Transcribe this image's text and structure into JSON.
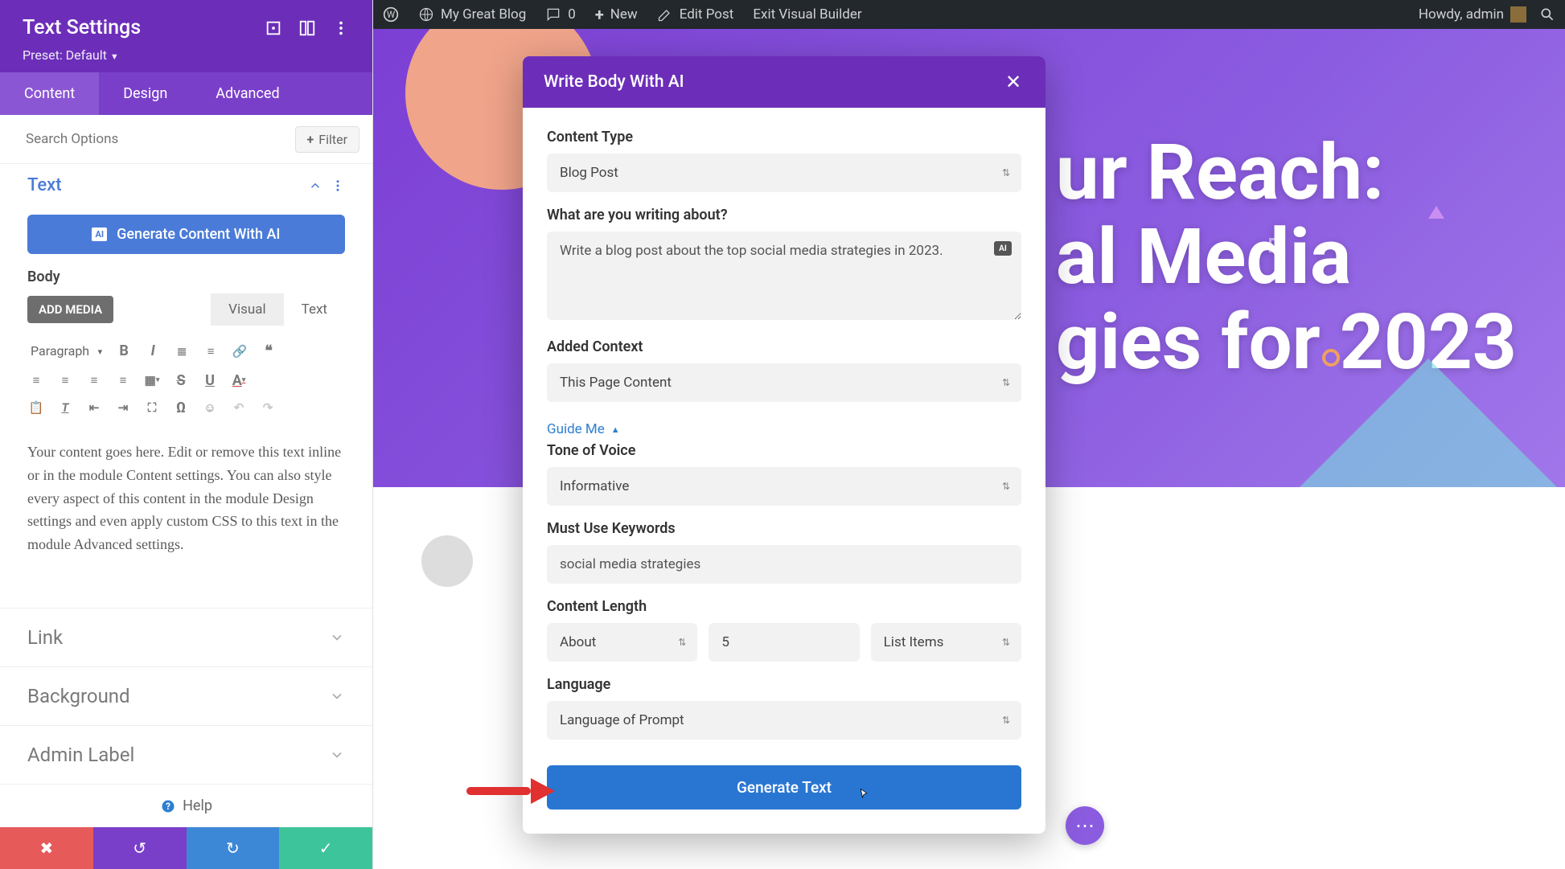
{
  "wp_bar": {
    "site_name": "My Great Blog",
    "comments_count": "0",
    "new_label": "New",
    "edit_post": "Edit Post",
    "exit_builder": "Exit Visual Builder",
    "howdy": "Howdy, admin"
  },
  "sidebar": {
    "title": "Text Settings",
    "preset": "Preset: Default",
    "tabs": [
      "Content",
      "Design",
      "Advanced"
    ],
    "active_tab": 0,
    "search_placeholder": "Search Options",
    "filter_label": "Filter",
    "section_text": "Text",
    "generate_btn": "Generate Content With AI",
    "body_label": "Body",
    "add_media": "ADD MEDIA",
    "visual_tab": "Visual",
    "text_tab": "Text",
    "para_label": "Paragraph",
    "editor_content": "Your content goes here. Edit or remove this text inline or in the module Content settings. You can also style every aspect of this content in the module Design settings and even apply custom CSS to this text in the module Advanced settings.",
    "accordions": [
      "Link",
      "Background",
      "Admin Label"
    ],
    "help": "Help"
  },
  "hero": {
    "title_line1": "ur Reach:",
    "title_line2": "al Media",
    "title_line3": "gies for 2023"
  },
  "modal": {
    "title": "Write Body With AI",
    "labels": {
      "content_type": "Content Type",
      "writing_about": "What are you writing about?",
      "added_context": "Added Context",
      "guide_me": "Guide Me",
      "tone": "Tone of Voice",
      "keywords": "Must Use Keywords",
      "content_length": "Content Length",
      "language": "Language"
    },
    "values": {
      "content_type": "Blog Post",
      "prompt": "Write a blog post about the top social media strategies in 2023.",
      "added_context": "This Page Content",
      "tone": "Informative",
      "keywords": "social media strategies",
      "length_mode": "About",
      "length_count": "5",
      "length_unit": "List Items",
      "language": "Language of Prompt"
    },
    "generate_btn": "Generate Text"
  }
}
